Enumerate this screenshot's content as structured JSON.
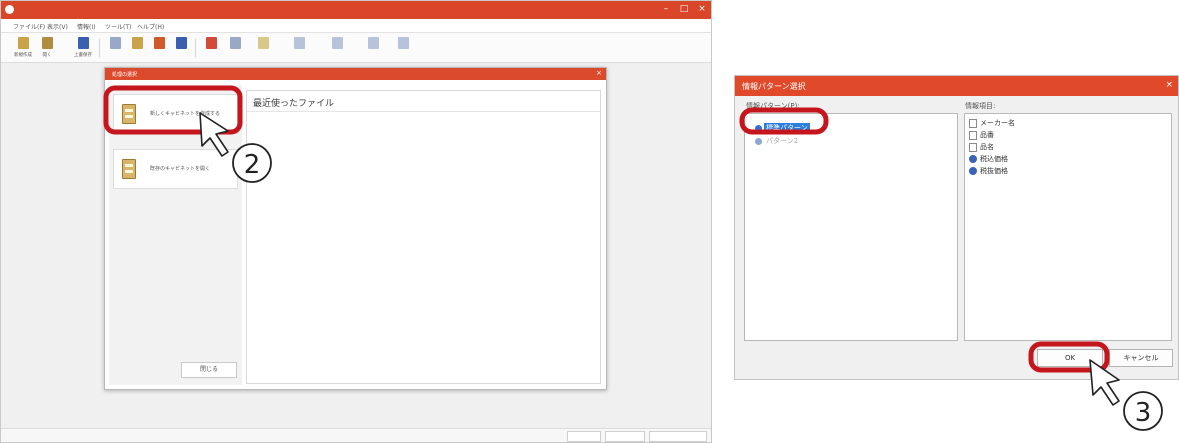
{
  "app": {
    "title": "",
    "menus": [
      "ファイル(F)",
      "表示(V)",
      "情報(I)",
      "ツール(T)",
      "ヘルプ(H)"
    ],
    "toolbar": [
      {
        "label": "新規作成",
        "icon": "new-file-icon",
        "color": "#c9a24a"
      },
      {
        "label": "開く",
        "icon": "open-folder-icon",
        "color": "#b08d3e"
      },
      {
        "label": "上書保存",
        "icon": "save-icon",
        "color": "#3a5fb0"
      },
      {
        "label": "",
        "icon": "import-icon",
        "color": "#9aa8c8"
      },
      {
        "label": "",
        "icon": "export-icon",
        "color": "#c9a24a"
      },
      {
        "label": "",
        "icon": "pdf-icon",
        "color": "#d05a2a"
      },
      {
        "label": "",
        "icon": "print-icon",
        "color": "#3a5fb0"
      },
      {
        "label": "",
        "icon": "delete-icon",
        "color": "#d14b3b"
      },
      {
        "label": "",
        "icon": "rotate-icon",
        "color": "#9aa8c8"
      },
      {
        "label": "",
        "icon": "copy-icon",
        "color": "#d8c88a"
      },
      {
        "label": "",
        "icon": "tool-icon",
        "color": "#b7c3da"
      },
      {
        "label": "",
        "icon": "layout-icon",
        "color": "#b7c3da"
      },
      {
        "label": "",
        "icon": "zoom-icon",
        "color": "#b7c3da"
      }
    ],
    "status_fields": [
      "",
      "",
      ""
    ]
  },
  "start_dialog": {
    "title": "処理の選択",
    "new_cabinet_label": "新しくキャビネットを作成する",
    "open_cabinet_label": "既存のキャビネットを開く",
    "close_button": "閉じる",
    "recent_title": "最近使ったファイル"
  },
  "pattern_dialog": {
    "title": "情報パターン選択",
    "patterns_label": "情報パターン(P):",
    "patterns": [
      {
        "label": "標準パターン",
        "selected": true
      },
      {
        "label": "パターン2",
        "selected": false
      }
    ],
    "items_label": "情報項目:",
    "items": [
      {
        "label": "メーカー名",
        "icon": "document-icon"
      },
      {
        "label": "品番",
        "icon": "document-icon"
      },
      {
        "label": "品名",
        "icon": "document-icon"
      },
      {
        "label": "税込価格",
        "icon": "price-icon"
      },
      {
        "label": "税抜価格",
        "icon": "price-icon"
      }
    ],
    "ok_button": "OK",
    "cancel_button": "キャンセル"
  },
  "callouts": {
    "step_2": "2",
    "step_3": "3",
    "highlight_color": "#c4161c"
  }
}
